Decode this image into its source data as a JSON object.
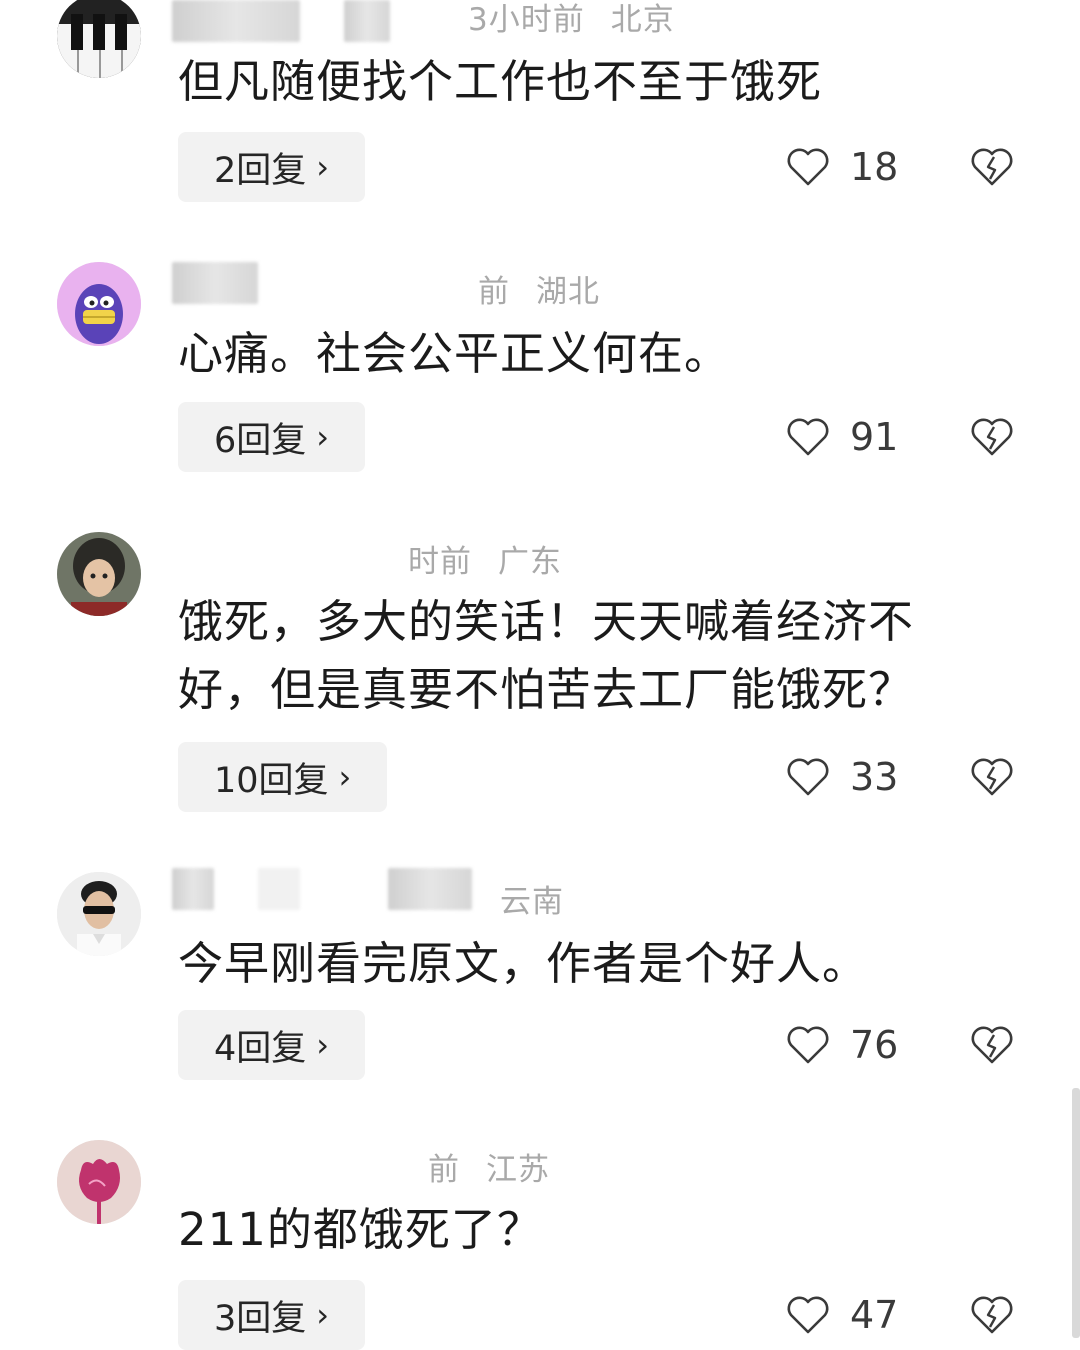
{
  "comments": [
    {
      "meta_time": "3小时前",
      "meta_location": "北京",
      "text": "但凡随便找个工作也不至于饿死",
      "reply_label": "2回复",
      "likes": "18",
      "avatar_icon": "piano-keys-avatar-icon"
    },
    {
      "meta_time": "前",
      "meta_location": "湖北",
      "text": "心痛。社会公平正义何在。",
      "reply_label": "6回复",
      "likes": "91",
      "avatar_icon": "purple-cartoon-avatar-icon"
    },
    {
      "meta_time": "时前",
      "meta_location": "广东",
      "text": "饿死，多大的笑话！天天喊着经济不好，但是真要不怕苦去工厂能饿死？",
      "reply_label": "10回复",
      "likes": "33",
      "avatar_icon": "child-photo-avatar-icon"
    },
    {
      "meta_time": "",
      "meta_location": "云南",
      "text": "今早刚看完原文，作者是个好人。",
      "reply_label": "4回复",
      "likes": "76",
      "avatar_icon": "man-sunglasses-avatar-icon"
    },
    {
      "meta_time": "前",
      "meta_location": "江苏",
      "text": "211的都饿死了？",
      "reply_label": "3回复",
      "likes": "47",
      "avatar_icon": "pink-flower-avatar-icon"
    }
  ],
  "icons": {
    "chevron": "›",
    "like": "heart-outline-icon",
    "dislike": "broken-heart-icon"
  },
  "colors": {
    "text": "#1b1b1b",
    "meta": "#a9a9a9",
    "reply_bg": "#f2f2f2"
  }
}
